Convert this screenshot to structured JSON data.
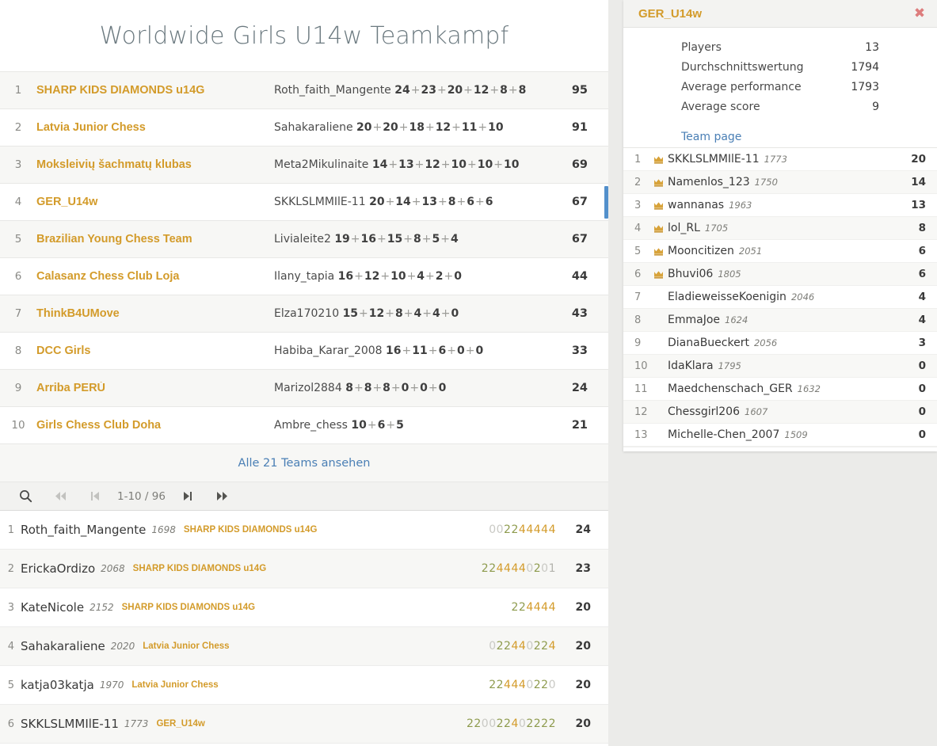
{
  "page": {
    "title": "Worldwide Girls U14w Teamkampf",
    "accent_color": "#d39b2a",
    "link_color": "#4a7fb5",
    "selected_bar_color": "#5390cb",
    "close_color": "#dd7d7d"
  },
  "teams": {
    "all_teams_link": "Alle 21 Teams ansehen",
    "rows": [
      {
        "rank": "1",
        "name": "SHARP KIDS DIAMONDS u14G",
        "leader": "Roth_faith_Mangente",
        "scores": [
          "24",
          "23",
          "20",
          "12",
          "8",
          "8"
        ],
        "total": "95",
        "selected": false
      },
      {
        "rank": "2",
        "name": "Latvia Junior Chess",
        "leader": "Sahakaraliene",
        "scores": [
          "20",
          "20",
          "18",
          "12",
          "11",
          "10"
        ],
        "total": "91",
        "selected": false
      },
      {
        "rank": "3",
        "name": "Moksleivių šachmatų klubas",
        "leader": "Meta2Mikulinaite",
        "scores": [
          "14",
          "13",
          "12",
          "10",
          "10",
          "10"
        ],
        "total": "69",
        "selected": false
      },
      {
        "rank": "4",
        "name": "GER_U14w",
        "leader": "SKKLSLMMIlE-11",
        "scores": [
          "20",
          "14",
          "13",
          "8",
          "6",
          "6"
        ],
        "total": "67",
        "selected": true
      },
      {
        "rank": "5",
        "name": "Brazilian Young Chess Team",
        "leader": "Livialeite2",
        "scores": [
          "19",
          "16",
          "15",
          "8",
          "5",
          "4"
        ],
        "total": "67",
        "selected": false
      },
      {
        "rank": "6",
        "name": "Calasanz Chess Club Loja",
        "leader": "Ilany_tapia",
        "scores": [
          "16",
          "12",
          "10",
          "4",
          "2",
          "0"
        ],
        "total": "44",
        "selected": false
      },
      {
        "rank": "7",
        "name": "ThinkB4UMove",
        "leader": "Elza170210",
        "scores": [
          "15",
          "12",
          "8",
          "4",
          "4",
          "0"
        ],
        "total": "43",
        "selected": false
      },
      {
        "rank": "8",
        "name": "DCC Girls",
        "leader": "Habiba_Karar_2008",
        "scores": [
          "16",
          "11",
          "6",
          "0",
          "0"
        ],
        "total": "33",
        "selected": false
      },
      {
        "rank": "9",
        "name": "Arriba PERÚ",
        "leader": "Marizol2884",
        "scores": [
          "8",
          "8",
          "8",
          "0",
          "0",
          "0"
        ],
        "total": "24",
        "selected": false
      },
      {
        "rank": "10",
        "name": "Girls Chess Club Doha",
        "leader": "Ambre_chess",
        "scores": [
          "10",
          "6",
          "5"
        ],
        "total": "21",
        "selected": false
      }
    ]
  },
  "pager": {
    "search_icon": "search-icon",
    "first_icon": "first-page-icon",
    "prev_icon": "previous-page-icon",
    "count": "1-10 / 96",
    "next_icon": "next-page-icon",
    "last_icon": "last-page-icon"
  },
  "players": {
    "rows": [
      {
        "rank": "1",
        "name": "Roth_faith_Mangente",
        "rating": "1698",
        "team": "SHARP KIDS DIAMONDS u14G",
        "sequence": "002244444",
        "total": "24"
      },
      {
        "rank": "2",
        "name": "ErickaOrdizo",
        "rating": "2068",
        "team": "SHARP KIDS DIAMONDS u14G",
        "sequence": "2244440201",
        "total": "23"
      },
      {
        "rank": "3",
        "name": "KateNicole",
        "rating": "2152",
        "team": "SHARP KIDS DIAMONDS u14G",
        "sequence": "224444",
        "total": "20"
      },
      {
        "rank": "4",
        "name": "Sahakaraliene",
        "rating": "2020",
        "team": "Latvia Junior Chess",
        "sequence": "022440224",
        "total": "20"
      },
      {
        "rank": "5",
        "name": "katja03katja",
        "rating": "1970",
        "team": "Latvia Junior Chess",
        "sequence": "224440220",
        "total": "20"
      },
      {
        "rank": "6",
        "name": "SKKLSLMMIlE-11",
        "rating": "1773",
        "team": "GER_U14w",
        "sequence": "220022402222",
        "total": "20"
      }
    ]
  },
  "side_panel": {
    "title": "GER_U14w",
    "close_icon": "close-icon",
    "stats": [
      {
        "label": "Players",
        "value": "13"
      },
      {
        "label": "Durchschnittswertung",
        "value": "1794"
      },
      {
        "label": "Average performance",
        "value": "1793"
      },
      {
        "label": "Average score",
        "value": "9"
      }
    ],
    "team_page_link": "Team page",
    "players": [
      {
        "rank": "1",
        "crown": true,
        "name": "SKKLSLMMIlE-11",
        "rating": "1773",
        "score": "20"
      },
      {
        "rank": "2",
        "crown": true,
        "name": "Namenlos_123",
        "rating": "1750",
        "score": "14"
      },
      {
        "rank": "3",
        "crown": true,
        "name": "wannanas",
        "rating": "1963",
        "score": "13"
      },
      {
        "rank": "4",
        "crown": true,
        "name": "lol_RL",
        "rating": "1705",
        "score": "8"
      },
      {
        "rank": "5",
        "crown": true,
        "name": "Mooncitizen",
        "rating": "2051",
        "score": "6"
      },
      {
        "rank": "6",
        "crown": true,
        "name": "Bhuvi06",
        "rating": "1805",
        "score": "6"
      },
      {
        "rank": "7",
        "crown": false,
        "name": "EladieweisseKoenigin",
        "rating": "2046",
        "score": "4"
      },
      {
        "rank": "8",
        "crown": false,
        "name": "EmmaJoe",
        "rating": "1624",
        "score": "4"
      },
      {
        "rank": "9",
        "crown": false,
        "name": "DianaBueckert",
        "rating": "2056",
        "score": "3"
      },
      {
        "rank": "10",
        "crown": false,
        "name": "IdaKlara",
        "rating": "1795",
        "score": "0"
      },
      {
        "rank": "11",
        "crown": false,
        "name": "Maedchenschach_GER",
        "rating": "1632",
        "score": "0"
      },
      {
        "rank": "12",
        "crown": false,
        "name": "Chessgirl206",
        "rating": "1607",
        "score": "0"
      },
      {
        "rank": "13",
        "crown": false,
        "name": "Michelle-Chen_2007",
        "rating": "1509",
        "score": "0"
      }
    ]
  }
}
